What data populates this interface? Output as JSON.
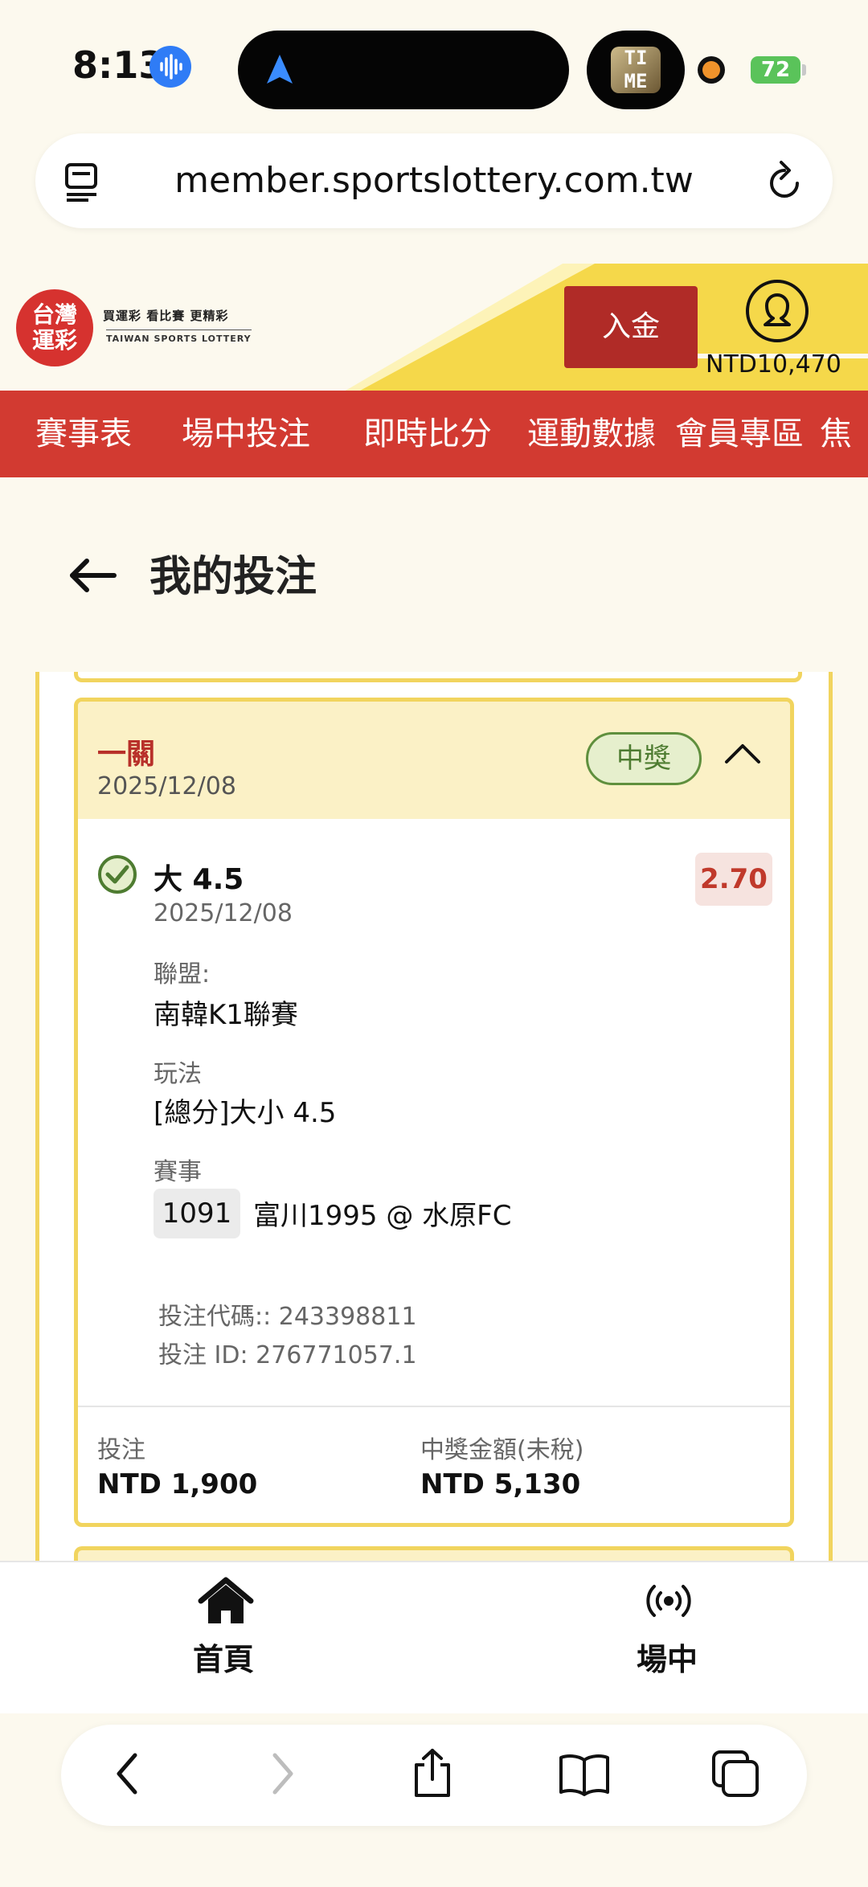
{
  "status_bar": {
    "time": "8:13",
    "battery": "72"
  },
  "pip": {
    "label": "TI ME"
  },
  "browser": {
    "url": "member.sportslottery.com.tw"
  },
  "site": {
    "logo_text": [
      "台灣",
      "運彩"
    ],
    "tagline": "買運彩 看比賽 更精彩",
    "tagline_en": "TAIWAN SPORTS LOTTERY",
    "deposit_label": "入金",
    "balance": "NTD10,470"
  },
  "nav": {
    "items": [
      "賽事表",
      "場中投注",
      "即時比分",
      "運動數據",
      "會員專區",
      "焦"
    ]
  },
  "page": {
    "title": "我的投注"
  },
  "bet": {
    "type": "一關",
    "date": "2025/12/08",
    "status": "中獎",
    "pick": "大 4.5",
    "pick_date": "2025/12/08",
    "odds": "2.70",
    "league_label": "聯盟:",
    "league": "南韓K1聯賽",
    "market_label": "玩法",
    "market": "[總分]大小 4.5",
    "event_label": "賽事",
    "event_number": "1091",
    "event_name": "富川1995 @ 水原FC",
    "code_label": "投注代碼:: 243398811",
    "id_label": "投注 ID: 276771057.1",
    "stake_label": "投注",
    "stake": "NTD 1,900",
    "payout_label": "中獎金額(未稅)",
    "payout": "NTD 5,130"
  },
  "tabbar": {
    "home": "首頁",
    "live": "場中"
  },
  "colors": {
    "brand_red": "#d23a31",
    "accent_yellow": "#f1d45e",
    "win_green": "#5f8f3d"
  }
}
